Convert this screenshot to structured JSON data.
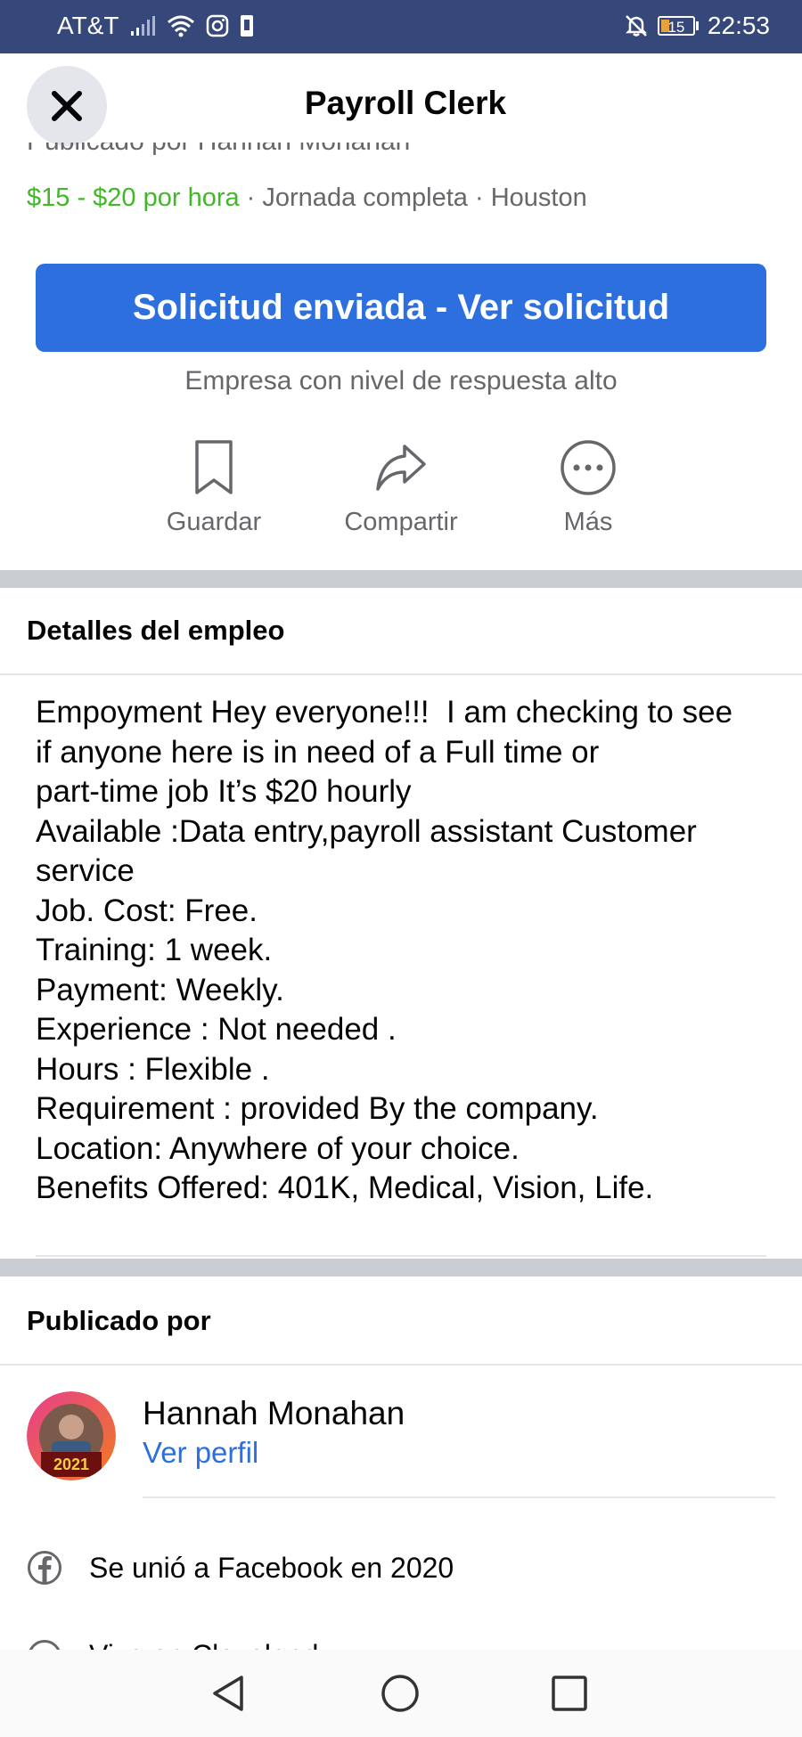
{
  "status_bar": {
    "carrier": "AT&T",
    "battery_level": "15",
    "time": "22:53",
    "icons": [
      "signal-icon",
      "wifi-icon",
      "instagram-icon",
      "sim-icon",
      "mute-icon",
      "battery-icon"
    ]
  },
  "header": {
    "title": "Payroll Clerk",
    "close_icon": "close-icon"
  },
  "job": {
    "posted_by_partial": "Publicado por Hannah Monahan",
    "pay": "$15 - $20 por hora",
    "details": " · Jornada completa · Houston",
    "apply_button": "Solicitud enviada - Ver solicitud",
    "response_note": "Empresa con nivel de respuesta alto"
  },
  "actions": [
    {
      "label": "Guardar",
      "icon": "bookmark-icon"
    },
    {
      "label": "Compartir",
      "icon": "share-icon"
    },
    {
      "label": "Más",
      "icon": "more-icon"
    }
  ],
  "details_section": {
    "title": "Detalles del empleo",
    "description": "Empoyment Hey everyone!!!  I am checking to see\nif anyone here is in need of a Full time or\npart-time job It’s $20 hourly\nAvailable :Data entry,payroll assistant Customer\nservice\nJob. Cost: Free.\nTraining: 1 week.\nPayment: Weekly.\nExperience : Not needed .\nHours : Flexible .\nRequirement : provided By the company.\nLocation: Anywhere of your choice.\nBenefits Offered: 401K, Medical, Vision, Life."
  },
  "poster_section": {
    "title": "Publicado por",
    "name": "Hannah Monahan",
    "profile_link": "Ver perfil",
    "avatar_text": "2021",
    "joined": "Se unió a Facebook en 2020",
    "next_row_partial": "Vive en Cleveland"
  },
  "nav_bar": {
    "icons": [
      "back-icon",
      "home-icon",
      "recents-icon"
    ]
  },
  "colors": {
    "status_bar_bg": "#36477a",
    "primary_blue": "#2d6fdf",
    "pay_green": "#42b72a",
    "secondary_text": "#65676b",
    "divider": "#c9ccd1"
  }
}
